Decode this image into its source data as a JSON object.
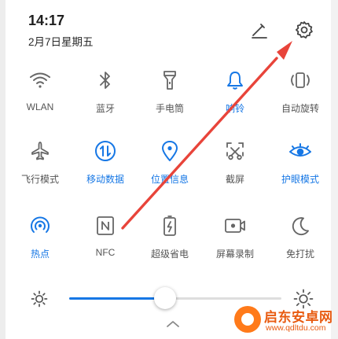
{
  "status": {
    "time": "14:17",
    "date": "2月7日星期五"
  },
  "header": {
    "edit_icon": "pencil-icon",
    "settings_icon": "gear-icon"
  },
  "tiles": [
    {
      "label": "WLAN",
      "icon": "wifi-icon",
      "on": false
    },
    {
      "label": "蓝牙",
      "icon": "bluetooth-icon",
      "on": false
    },
    {
      "label": "手电筒",
      "icon": "flashlight-icon",
      "on": false
    },
    {
      "label": "响铃",
      "icon": "bell-icon",
      "on": true
    },
    {
      "label": "自动旋转",
      "icon": "auto-rotate-icon",
      "on": false
    },
    {
      "label": "飞行模式",
      "icon": "airplane-icon",
      "on": false
    },
    {
      "label": "移动数据",
      "icon": "mobile-data-icon",
      "on": true
    },
    {
      "label": "位置信息",
      "icon": "location-icon",
      "on": true
    },
    {
      "label": "截屏",
      "icon": "screenshot-icon",
      "on": false
    },
    {
      "label": "护眼模式",
      "icon": "eye-icon",
      "on": true
    },
    {
      "label": "热点",
      "icon": "hotspot-icon",
      "on": true
    },
    {
      "label": "NFC",
      "icon": "nfc-icon",
      "on": false
    },
    {
      "label": "超级省电",
      "icon": "battery-saver-icon",
      "on": false
    },
    {
      "label": "屏幕录制",
      "icon": "screen-record-icon",
      "on": false
    },
    {
      "label": "免打扰",
      "icon": "moon-icon",
      "on": false
    }
  ],
  "brightness": {
    "level": 0.45,
    "auto_icon": "brightness-icon"
  },
  "watermark": {
    "name": "启东安卓网",
    "url": "www.qdltdu.com"
  },
  "colors": {
    "accent": "#1677e5",
    "icon": "#666666",
    "annotation": "#e8443a",
    "watermark": "#e85b11"
  }
}
